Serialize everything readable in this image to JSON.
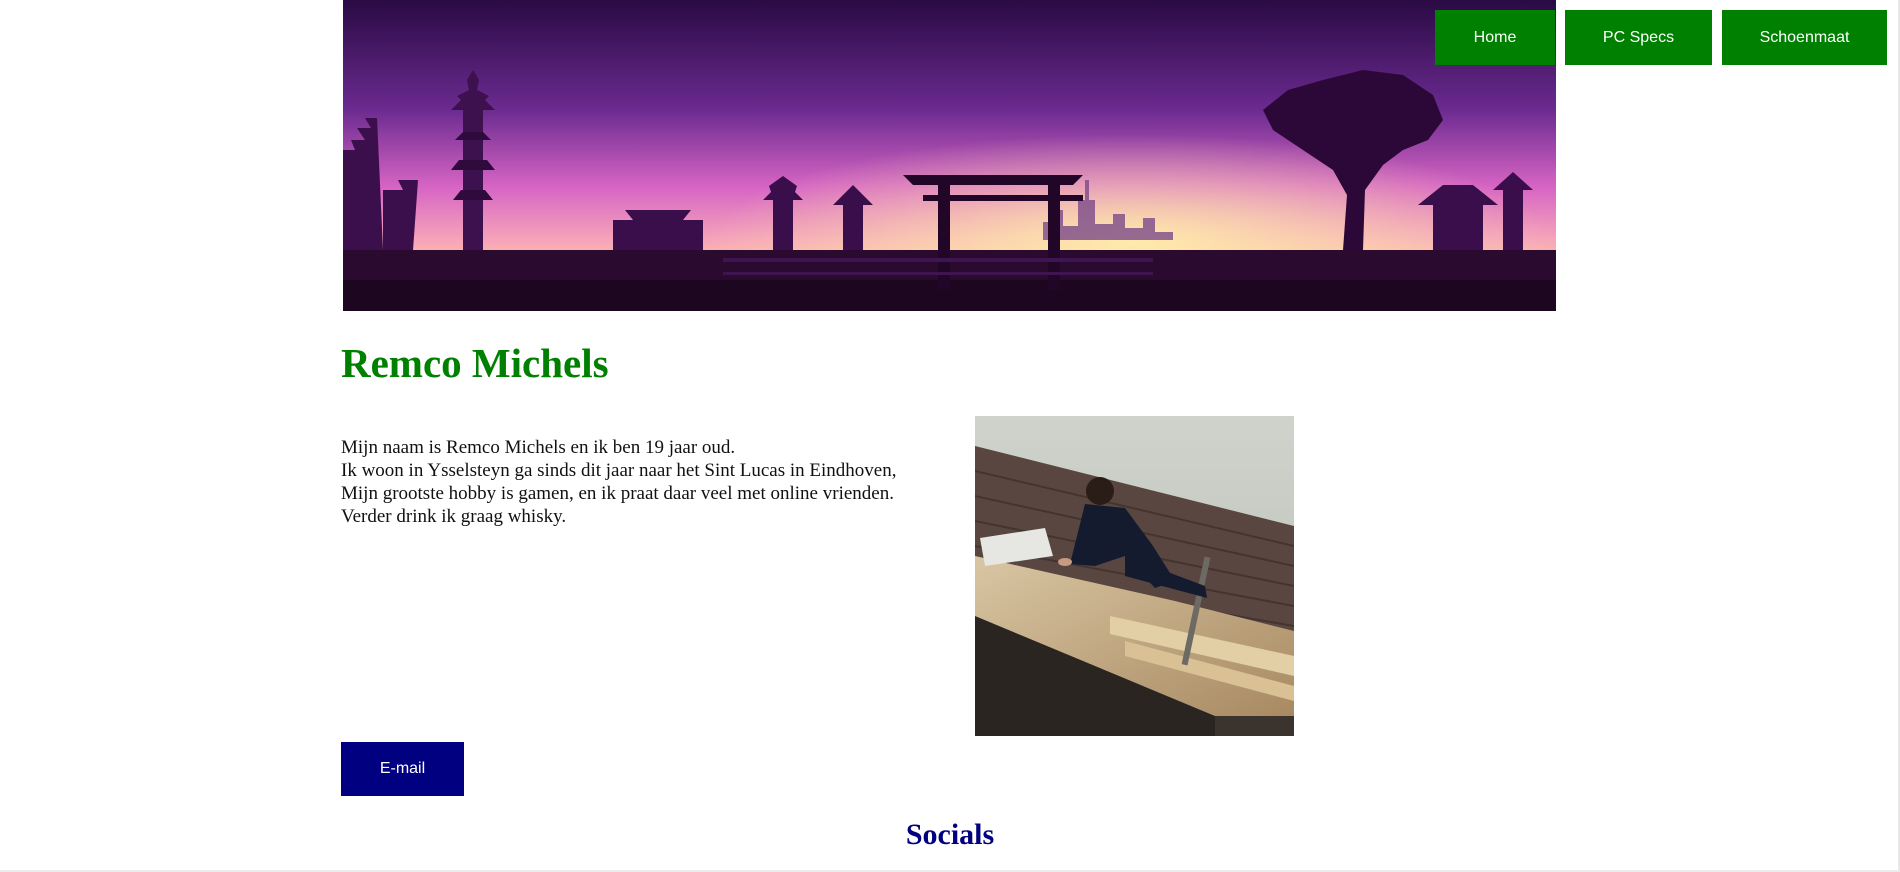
{
  "nav": {
    "home_label": "Home",
    "pcspecs_label": "PC Specs",
    "schoenmaat_label": "Schoenmaat",
    "color": "#008000"
  },
  "profile": {
    "name": "Remco Michels",
    "intro_lines": [
      "Mijn naam is Remco Michels en ik ben 19 jaar oud.",
      "Ik woon in Ysselsteyn ga sinds dit jaar naar het Sint Lucas in Eindhoven,",
      "Mijn grootste hobby is gamen, en ik praat daar veel met online vrienden.",
      "Verder drink ik graag whisky."
    ]
  },
  "email": {
    "label": "E-mail",
    "color": "#000080"
  },
  "socials": {
    "heading": "Socials"
  },
  "colors": {
    "heading_green": "#008000",
    "navy": "#000080",
    "banner_sky_top": "#2b0a45",
    "banner_sky_mid": "#e86cc8",
    "banner_sky_glow": "#ffd27a"
  },
  "images": {
    "banner": "asian-skyline-sunset-banner",
    "photo": "person-working-on-roof"
  }
}
